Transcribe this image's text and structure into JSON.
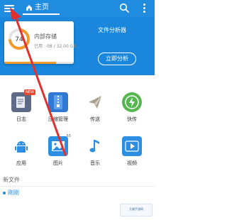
{
  "topbar": {
    "home_tab_label": "主页",
    "menu_icon": "menu-icon",
    "search_icon": "search-icon",
    "more_icon": "more-vertical-icon",
    "color": "#1f8ce0"
  },
  "storage": {
    "percent_label": "74",
    "title": "内部存储",
    "detail": "已用 : 0B / 32.00 GB",
    "used_fraction": 0.74,
    "accent": "#f39a2c"
  },
  "analyzer": {
    "title": "文件分析器",
    "button_label": "立即分析"
  },
  "grid": [
    {
      "name": "日志",
      "icon": "log-book-icon",
      "badge": "NEW",
      "color": "#5d6b86"
    },
    {
      "name": "压缩管理",
      "icon": "zip-icon",
      "badge": "",
      "color": "#2f79d4"
    },
    {
      "name": "传送",
      "icon": "send-plane-icon",
      "badge": "",
      "color": "#a89f8f"
    },
    {
      "name": "快传",
      "icon": "quick-transfer-icon",
      "badge": "",
      "color": "#55b84e"
    },
    {
      "name": "应用",
      "icon": "android-icon",
      "badge": "",
      "color": "#2d8fe2"
    },
    {
      "name": "图片",
      "icon": "image-icon",
      "badge": "55",
      "color": "#2d8fe2"
    },
    {
      "name": "音乐",
      "icon": "music-icon",
      "badge": "",
      "color": "#2d8fe2"
    },
    {
      "name": "视频",
      "icon": "video-icon",
      "badge": "",
      "color": "#2d8fe2"
    }
  ],
  "recent": {
    "section_label": "新文件",
    "first_item": "刚刚"
  },
  "watermark": {
    "text": "大福手游网"
  },
  "annotation": {
    "arrow_color": "#e03030"
  }
}
